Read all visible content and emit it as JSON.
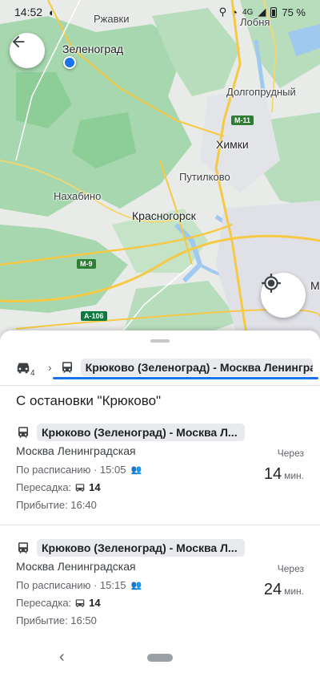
{
  "status_bar": {
    "time": "14:52",
    "signal": "4G",
    "battery": "75 %"
  },
  "map": {
    "labels": {
      "rzhavki": "Ржавки",
      "zelenograd": "Зеленоград",
      "lobnya": "Лобня",
      "dolgoprudny": "Долгопрудный",
      "khimki": "Химки",
      "putilkovo": "Путилково",
      "nakhabino": "Нахабино",
      "krasnogorsk": "Красногорск",
      "moskva_edge": "М"
    },
    "shields": {
      "m11": "М-11",
      "m9": "М-9",
      "a106": "А-106"
    }
  },
  "route_bar": {
    "car_count": "4",
    "route_chip": "Крюково (Зеленоград) - Москва Ленинград"
  },
  "section_title": "С остановки \"Крюково\"",
  "trips": [
    {
      "chip": "Крюково (Зеленоград) - Москва Л...",
      "destination": "Москва Ленинградская",
      "scheduled_label": "По расписанию · 15:05",
      "transfer_label": "Пересадка:",
      "transfer_num": "14",
      "arrival": "Прибытие: 16:40",
      "through": "Через",
      "eta": "14",
      "eta_unit": "мин."
    },
    {
      "chip": "Крюково (Зеленоград) - Москва Л...",
      "destination": "Москва Ленинградская",
      "scheduled_label": "По расписанию · 15:15",
      "transfer_label": "Пересадка:",
      "transfer_num": "14",
      "arrival": "Прибытие: 16:50",
      "through": "Через",
      "eta": "24",
      "eta_unit": "мин."
    }
  ],
  "colors": {
    "accent": "#1a73e8",
    "forest": "#a8d8b0",
    "water": "#9fc9ee",
    "road": "#f6c945"
  },
  "icons": [
    "back-arrow-icon",
    "my-location-icon",
    "car-icon",
    "train-icon",
    "bus-icon",
    "crowd-icon",
    "nav-back-icon"
  ]
}
